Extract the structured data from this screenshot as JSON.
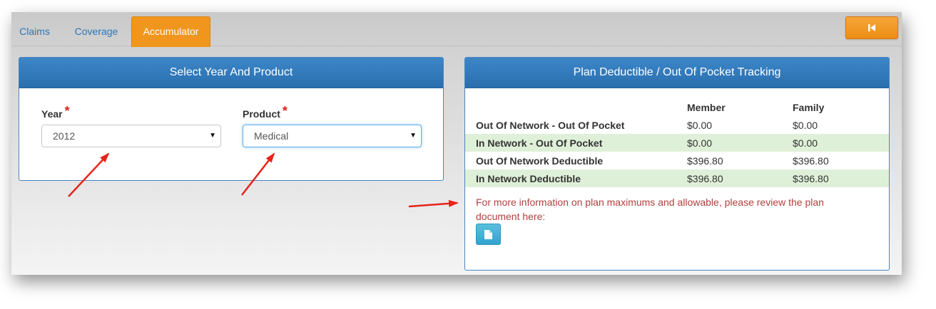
{
  "tabs": [
    {
      "label": "Claims",
      "active": false
    },
    {
      "label": "Coverage",
      "active": false
    },
    {
      "label": "Accumulator",
      "active": true
    }
  ],
  "toolbar": {
    "back_icon": "skip-back-icon"
  },
  "select_panel": {
    "title": "Select Year And Product",
    "year": {
      "label": "Year",
      "required_mark": "*",
      "value": "2012"
    },
    "product": {
      "label": "Product",
      "required_mark": "*",
      "value": "Medical"
    }
  },
  "tracking_panel": {
    "title": "Plan Deductible / Out Of Pocket Tracking",
    "columns": [
      "Member",
      "Family"
    ],
    "rows": [
      {
        "label": "Out Of Network - Out Of Pocket",
        "member": "$0.00",
        "family": "$0.00"
      },
      {
        "label": "In Network - Out Of Pocket",
        "member": "$0.00",
        "family": "$0.00"
      },
      {
        "label": "Out Of Network Deductible",
        "member": "$396.80",
        "family": "$396.80"
      },
      {
        "label": "In Network Deductible",
        "member": "$396.80",
        "family": "$396.80"
      }
    ],
    "info_text": "For more information on plan maximums and allowable, please review the plan document here:",
    "doc_icon": "document-icon"
  },
  "colors": {
    "accent_orange": "#f0961e",
    "header_blue": "#2f78b9",
    "link_blue": "#2f77b7",
    "row_highlight": "#dff0d8",
    "info_text": "#b0413e",
    "annotation_arrow": "#e8231a"
  }
}
